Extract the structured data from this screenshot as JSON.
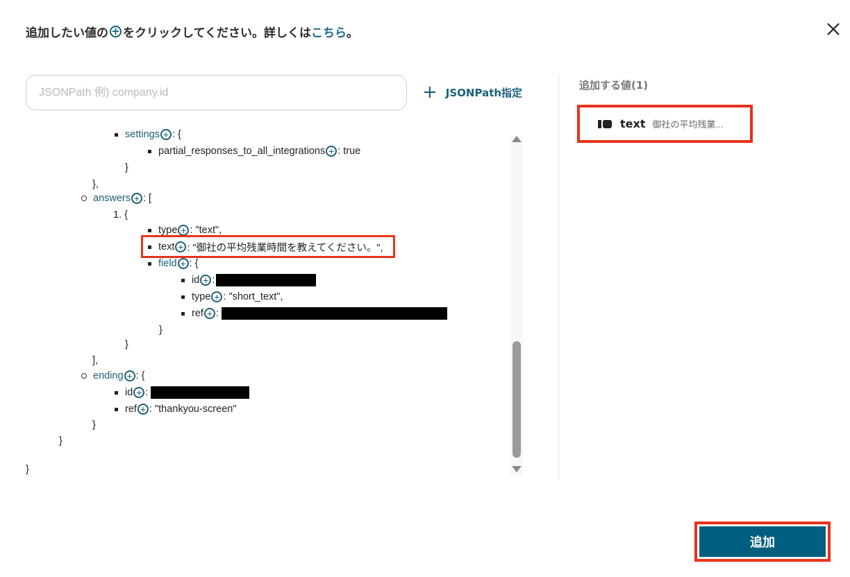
{
  "header": {
    "prefix": "追加したい値の",
    "plus_symbol": "+",
    "middle": "をクリックしてください。詳しくは",
    "link_text": "こちら",
    "suffix": "。"
  },
  "search": {
    "placeholder": "JSONPath 例) company.id",
    "value": ""
  },
  "jsonpath_button": {
    "icon": "+",
    "label": "JSONPath指定"
  },
  "tree": {
    "settings_key": "settings",
    "settings_open": ": {",
    "partial_key": "partial_responses_to_all_integrations",
    "partial_value": ": true",
    "close_brace": "}",
    "close_brace_comma": "},",
    "answers_key": "answers",
    "answers_open": ": [",
    "item_index": "1. {",
    "type_key": "type",
    "type_value": ": \"text\",",
    "text_key": "text",
    "text_value": ": \"御社の平均残業時間を教えてください。\",",
    "field_key": "field",
    "field_open": ": {",
    "id_key": "id",
    "colon": ":",
    "type2_value": ": \"short_text\",",
    "ref_key": "ref",
    "close_bracket_comma": "],",
    "ending_key": "ending",
    "ending_open": ": {",
    "ref_value": ": \"thankyou-screen\""
  },
  "right_panel": {
    "title": "追加する値(1)",
    "chip_name": "text",
    "chip_value": "御社の平均残業..."
  },
  "footer": {
    "add_label": "追加"
  },
  "colors": {
    "accent": "#1a5f7a",
    "primary_button": "#005f80",
    "highlight": "#e8321c"
  }
}
